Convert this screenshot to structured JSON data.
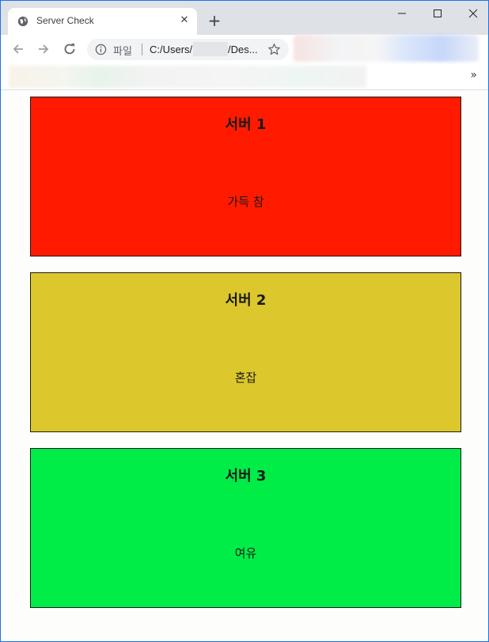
{
  "browser": {
    "tab_title": "Server Check",
    "tab_close_glyph": "✕",
    "new_tab_glyph": "+",
    "omnibox": {
      "scheme_label": "파일",
      "url_prefix": "C:/Users/",
      "url_suffix": "/Des...",
      "url_middle_redacted": true
    },
    "bookmarks_overflow_glyph": "»",
    "icons": {
      "favicon": "globe-icon",
      "back": "arrow-left-icon",
      "forward": "arrow-right-icon",
      "reload": "reload-icon",
      "info": "info-icon",
      "star": "star-icon",
      "minimize": "minimize-icon",
      "maximize": "maximize-icon",
      "close": "close-icon"
    }
  },
  "servers": [
    {
      "name": "서버 1",
      "status": "가득 참",
      "color": "#ff1a00"
    },
    {
      "name": "서버 2",
      "status": "혼잡",
      "color": "#dcc72c"
    },
    {
      "name": "서버 3",
      "status": "여유",
      "color": "#00ec47"
    }
  ]
}
